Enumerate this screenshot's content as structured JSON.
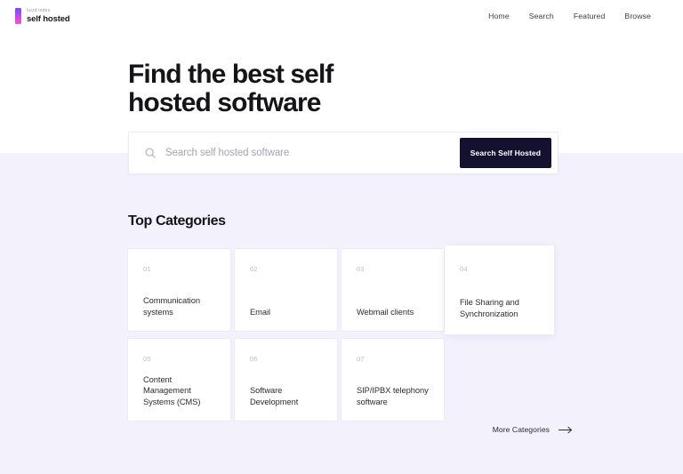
{
  "theme": {
    "page_background": "#f3f1fc",
    "band_background": "#ffffff",
    "button_background": "#14102f",
    "button_text": "#ffffff",
    "heading_color": "#141419",
    "muted_text": "#bdbdc9"
  },
  "header": {
    "brand": {
      "eyebrow": "lucid index",
      "name": "self hosted",
      "mark_icon": "gradient-bar-logo-icon"
    },
    "nav": [
      {
        "label": "Home"
      },
      {
        "label": "Search"
      },
      {
        "label": "Featured"
      },
      {
        "label": "Browse"
      }
    ]
  },
  "hero": {
    "title": "Find the best self hosted software"
  },
  "search": {
    "icon": "search-icon",
    "placeholder": "Search self hosted software",
    "value": "",
    "button_label": "Search Self Hosted"
  },
  "categories": {
    "title": "Top Categories",
    "items": [
      {
        "number": "01",
        "label": "Communication systems"
      },
      {
        "number": "02",
        "label": "Email"
      },
      {
        "number": "03",
        "label": "Webmail clients"
      },
      {
        "number": "04",
        "label": "File Sharing and Synchronization"
      },
      {
        "number": "05",
        "label": "Content Management Systems (CMS)"
      },
      {
        "number": "06",
        "label": "Software Development"
      },
      {
        "number": "07",
        "label": "SIP/IPBX telephony software"
      }
    ],
    "more_link": {
      "label": "More Categories",
      "icon": "arrow-right-icon"
    }
  }
}
